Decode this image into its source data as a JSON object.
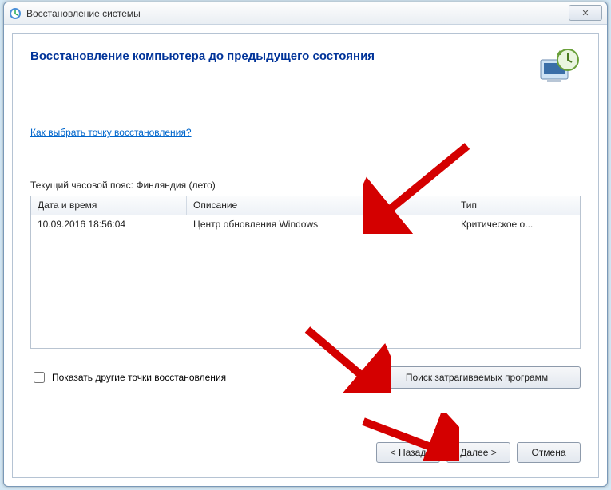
{
  "window": {
    "title": "Восстановление системы",
    "close_symbol": "✕"
  },
  "main": {
    "heading": "Восстановление компьютера до предыдущего состояния",
    "help_link": "Как выбрать точку восстановления?",
    "timezone_label": "Текущий часовой пояс: Финляндия (лето)"
  },
  "table": {
    "headers": {
      "datetime": "Дата и время",
      "description": "Описание",
      "type": "Тип"
    },
    "rows": [
      {
        "datetime": "10.09.2016 18:56:04",
        "description": "Центр обновления Windows",
        "type": "Критическое о..."
      }
    ]
  },
  "controls": {
    "show_more_label": "Показать другие точки восстановления",
    "show_more_checked": false,
    "scan_button": "Поиск затрагиваемых программ"
  },
  "footer": {
    "back": "< Назад",
    "next": "Далее >",
    "cancel": "Отмена"
  }
}
